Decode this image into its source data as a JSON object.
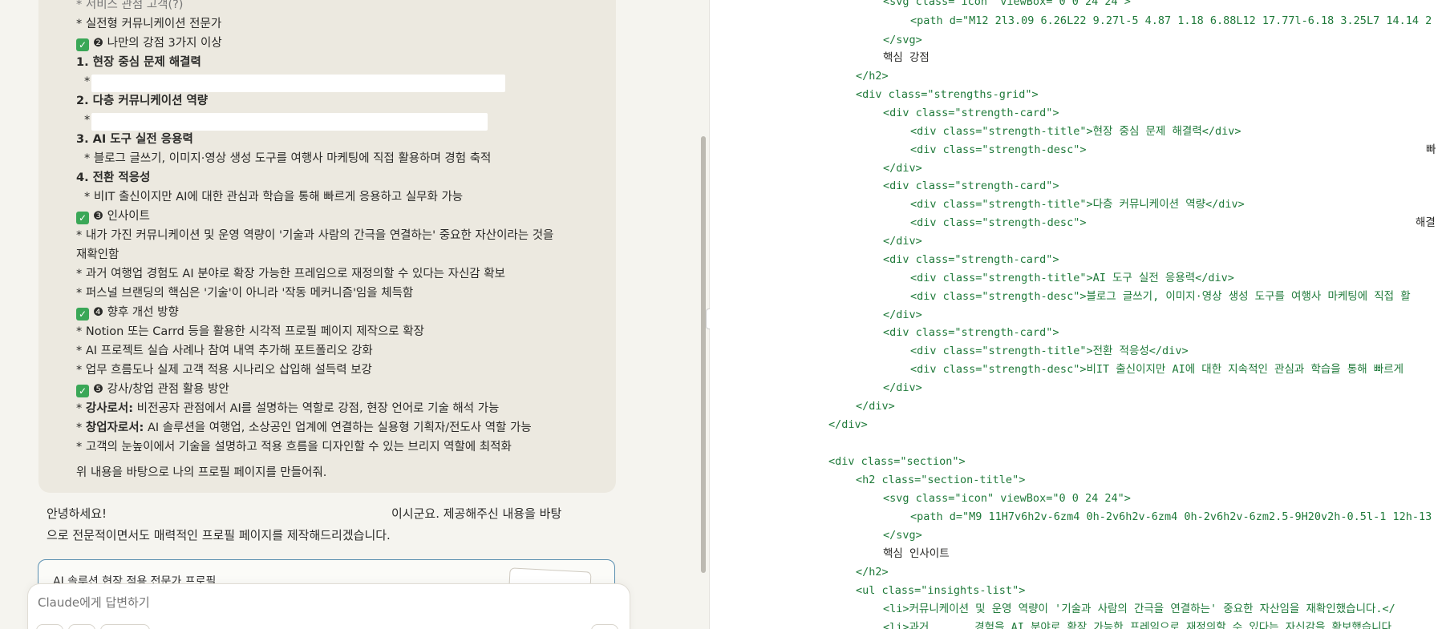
{
  "user_message": {
    "lines": [
      "* 서비스 관점 고객(?)",
      "* 실전형 커뮤니케이션 전문가",
      "❷ 나만의 강점 3가지 이상",
      "1. 현장 중심 문제 해결력",
      "*",
      "2. 다층 커뮤니케이션 역량",
      "*",
      "3. AI 도구 실전 응용력",
      "* 블로그 글쓰기, 이미지·영상 생성 도구를 여행사 마케팅에 직접 활용하며 경험 축적",
      "4. 전환 적응성",
      "* 비IT 출신이지만 AI에 대한 관심과 학습을 통해 빠르게 응용하고 실무화 가능",
      "❸ 인사이트",
      "* 내가 가진 커뮤니케이션 및 운영 역량이 '기술과 사람의 간극을 연결하는' 중요한 자산이라는 것을",
      "재확인함",
      "* 과거 여행업 경험도 AI 분야로 확장 가능한 프레임으로 재정의할 수 있다는 자신감 확보",
      "* 퍼스널 브랜딩의 핵심은 '기술'이 아니라 '작동 메커니즘'임을 체득함",
      "❹ 향후 개선 방향",
      "* Notion 또는 Carrd 등을 활용한 시각적 프로필 페이지 제작으로 확장",
      "* AI 프로젝트 실습 사례나 참여 내역 추가해 포트폴리오 강화",
      "* 업무 흐름도나 실제 고객 적용 시나리오 삽입해 설득력 보강",
      "❺ 강사/창업 관점 활용 방안",
      "강사로서:",
      " 비전공자 관점에서 AI를 설명하는 역할로 강점, 현장 언어로 기술 해석 가능",
      "창업자로서:",
      " AI 솔루션을 여행업, 소상공인 업계에 연결하는 실용형 기획자/전도사 역할 가능",
      "* 고객의 눈높이에서 기술을 설명하고 적용 흐름을 디자인할 수 있는 브리지 역할에 최적화",
      "위 내용을 바탕으로 나의 프로필 페이지를 만들어줘."
    ]
  },
  "assistant_reply": {
    "line1_start": "안녕하세요!",
    "line1_end": "이시군요. 제공해주신 내용을 바탕",
    "line2": "으로 전문적이면서도 매력적인 프로필 페이지를 제작해드리겠습니다."
  },
  "artifact": {
    "title": "AI 솔루션 현장 적용 전문가 프로필"
  },
  "composer": {
    "placeholder": "Claude에게 답변하기"
  },
  "code": {
    "lines": [
      "<svg class=\"icon\" viewBox=\"0 0 24 24\">",
      "<path d=\"M12 2l3.09 6.26L22 9.27l-5 4.87 1.18 6.88L12 17.77l-6.18 3.25L7 14.14 2",
      "</svg>",
      "핵심 강점",
      "</h2>",
      "<div class=\"strengths-grid\">",
      "<div class=\"strength-card\">",
      "<div class=\"strength-title\">현장 중심 문제 해결력</div>",
      "<div class=\"strength-desc\">",
      "</div>",
      "<div class=\"strength-card\">",
      "<div class=\"strength-title\">다층 커뮤니케이션 역량</div>",
      "<div class=\"strength-desc\">",
      "</div>",
      "<div class=\"strength-card\">",
      "<div class=\"strength-title\">AI 도구 실전 응용력</div>",
      "<div class=\"strength-desc\">블로그 글쓰기, 이미지·영상 생성 도구를 여행사 마케팅에 직접 활",
      "</div>",
      "<div class=\"strength-card\">",
      "<div class=\"strength-title\">전환 적응성</div>",
      "<div class=\"strength-desc\">비IT 출신이지만 AI에 대한 지속적인 관심과 학습을 통해 빠르게",
      "</div>",
      "</div>",
      "</div>",
      "",
      "<div class=\"section\">",
      "<h2 class=\"section-title\">",
      "<svg class=\"icon\" viewBox=\"0 0 24 24\">",
      "<path d=\"M9 11H7v6h2v-6zm4 0h-2v6h2v-6zm4 0h-2v6h2v-6zm2.5-9H20v2h-0.5l-1 12h-13",
      "</svg>",
      "핵심 인사이트",
      "</h2>",
      "<ul class=\"insights-list\">",
      "<li>커뮤니케이션 및 운영 역량이 '기술과 사람의 간극을 연결하는' 중요한 자산임을 재확인했습니다.</",
      "<li>과거       경험을 AI 분야로 확장 가능한 프레임으로 재정의할 수 있다는 자신감을 확보했습니다."
    ],
    "trail_1": "빠",
    "trail_2": "해결"
  }
}
